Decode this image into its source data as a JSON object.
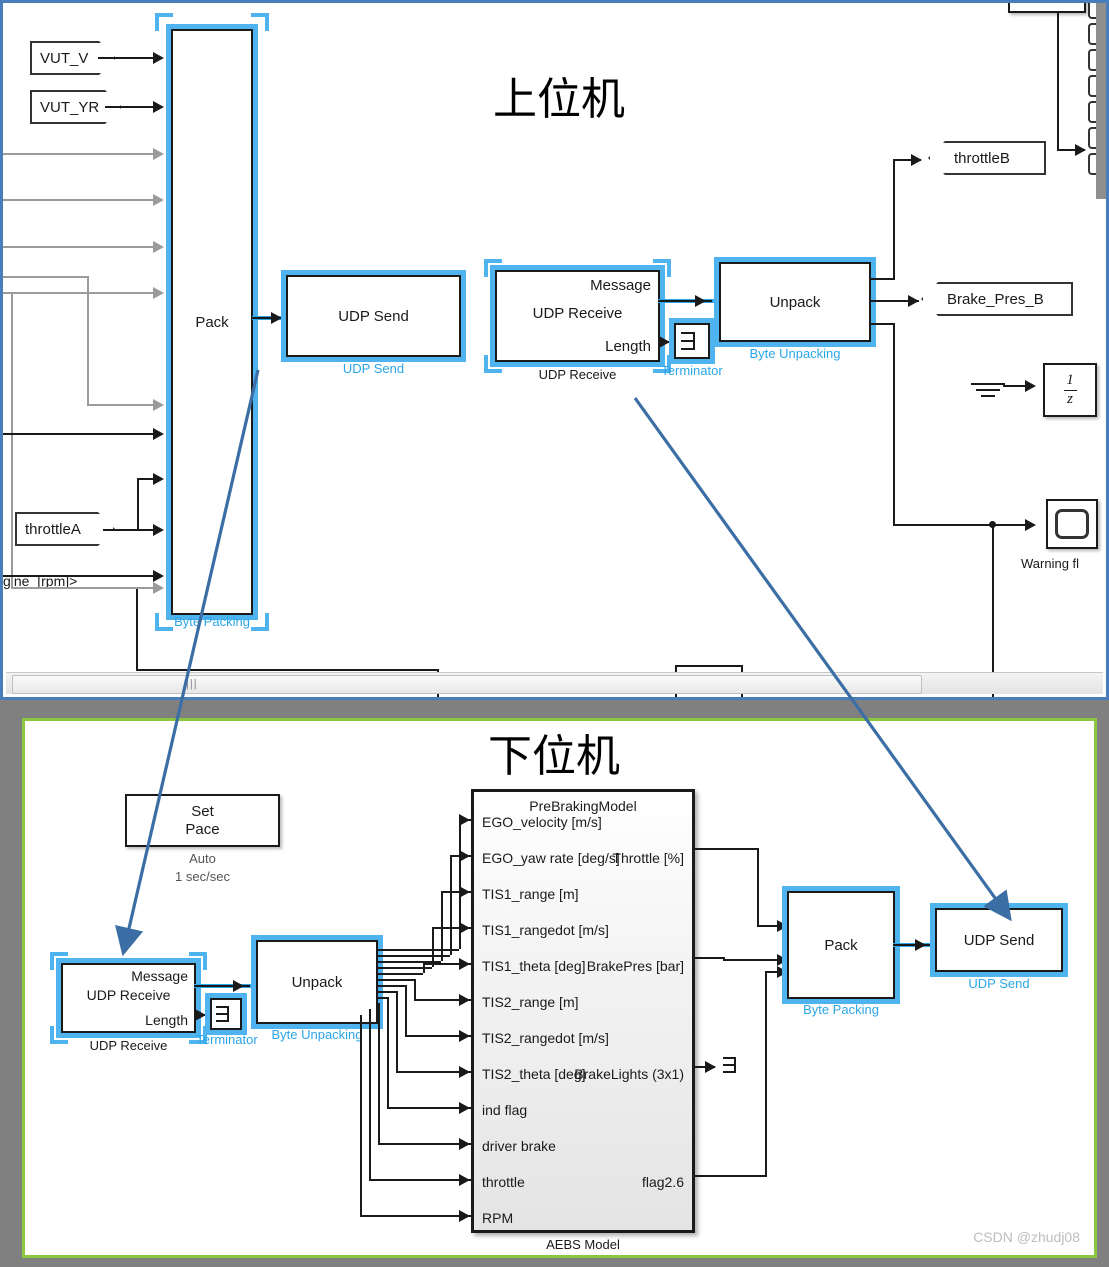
{
  "meta": {
    "watermark": "CSDN @zhudj08",
    "accent_blue": "#2ba6e8",
    "selection_blue": "#4fb3f0",
    "annotation_blue": "#3a6ea5",
    "top_border": "#4a7ebb",
    "bottom_border": "#8cc63f",
    "background_gray": "#808080"
  },
  "top_panel": {
    "heading": "上位机",
    "inports": [
      {
        "label": "VUT_V"
      },
      {
        "label": "VUT_YR"
      },
      {
        "label": "throttleA"
      },
      {
        "label": "gine_[rpm]>"
      }
    ],
    "blocks": {
      "pack": {
        "text": "Pack",
        "label": "Byte Packing",
        "selected": true
      },
      "udp_send": {
        "text": "UDP Send",
        "label": "UDP Send",
        "selected": true
      },
      "udp_receive": {
        "text_top": "Message",
        "text_mid": "UDP Receive",
        "text_bot": "Length",
        "label": "UDP Receive",
        "selected": true
      },
      "terminator": {
        "label": "Terminator",
        "selected": true
      },
      "unpack": {
        "text": "Unpack",
        "label": "Byte Unpacking",
        "selected": true
      },
      "unit_delay": {
        "numerator": "1",
        "denominator": "z"
      },
      "scope": {
        "label": "Warning fl"
      }
    },
    "outports": [
      {
        "label": "throttleB"
      },
      {
        "label": "Brake_Pres_B"
      }
    ]
  },
  "bottom_panel": {
    "heading": "下位机",
    "blocks": {
      "set_pace": {
        "line1": "Set",
        "line2": "Pace",
        "sub1": "Auto",
        "sub2": "1 sec/sec"
      },
      "udp_receive": {
        "text_top": "Message",
        "text_mid": "UDP Receive",
        "text_bot": "Length",
        "label": "UDP Receive",
        "selected": true
      },
      "terminator": {
        "label": "Terminator",
        "selected": true
      },
      "unpack": {
        "text": "Unpack",
        "label": "Byte Unpacking",
        "selected": true
      },
      "pack": {
        "text": "Pack",
        "label": "Byte Packing",
        "selected": true
      },
      "udp_send": {
        "text": "UDP Send",
        "label": "UDP Send",
        "selected": true
      }
    },
    "aebs": {
      "title": "PreBrakingModel",
      "label": "AEBS Model",
      "inputs": [
        "EGO_velocity [m/s]",
        "EGO_yaw rate [deg/s]",
        "TIS1_range [m]",
        "TIS1_rangedot [m/s]",
        "TIS1_theta [deg]",
        "TIS2_range [m]",
        "TIS2_rangedot [m/s]",
        "TIS2_theta [deg]",
        "ind flag",
        "driver brake",
        "throttle",
        "RPM"
      ],
      "outputs": [
        {
          "name": "Throttle [%]",
          "row": 1
        },
        {
          "name": "BrakePres [bar]",
          "row": 4
        },
        {
          "name": "BrakeLights (3x1)",
          "row": 7
        },
        {
          "name": "flag2.6",
          "row": 10
        }
      ]
    }
  }
}
